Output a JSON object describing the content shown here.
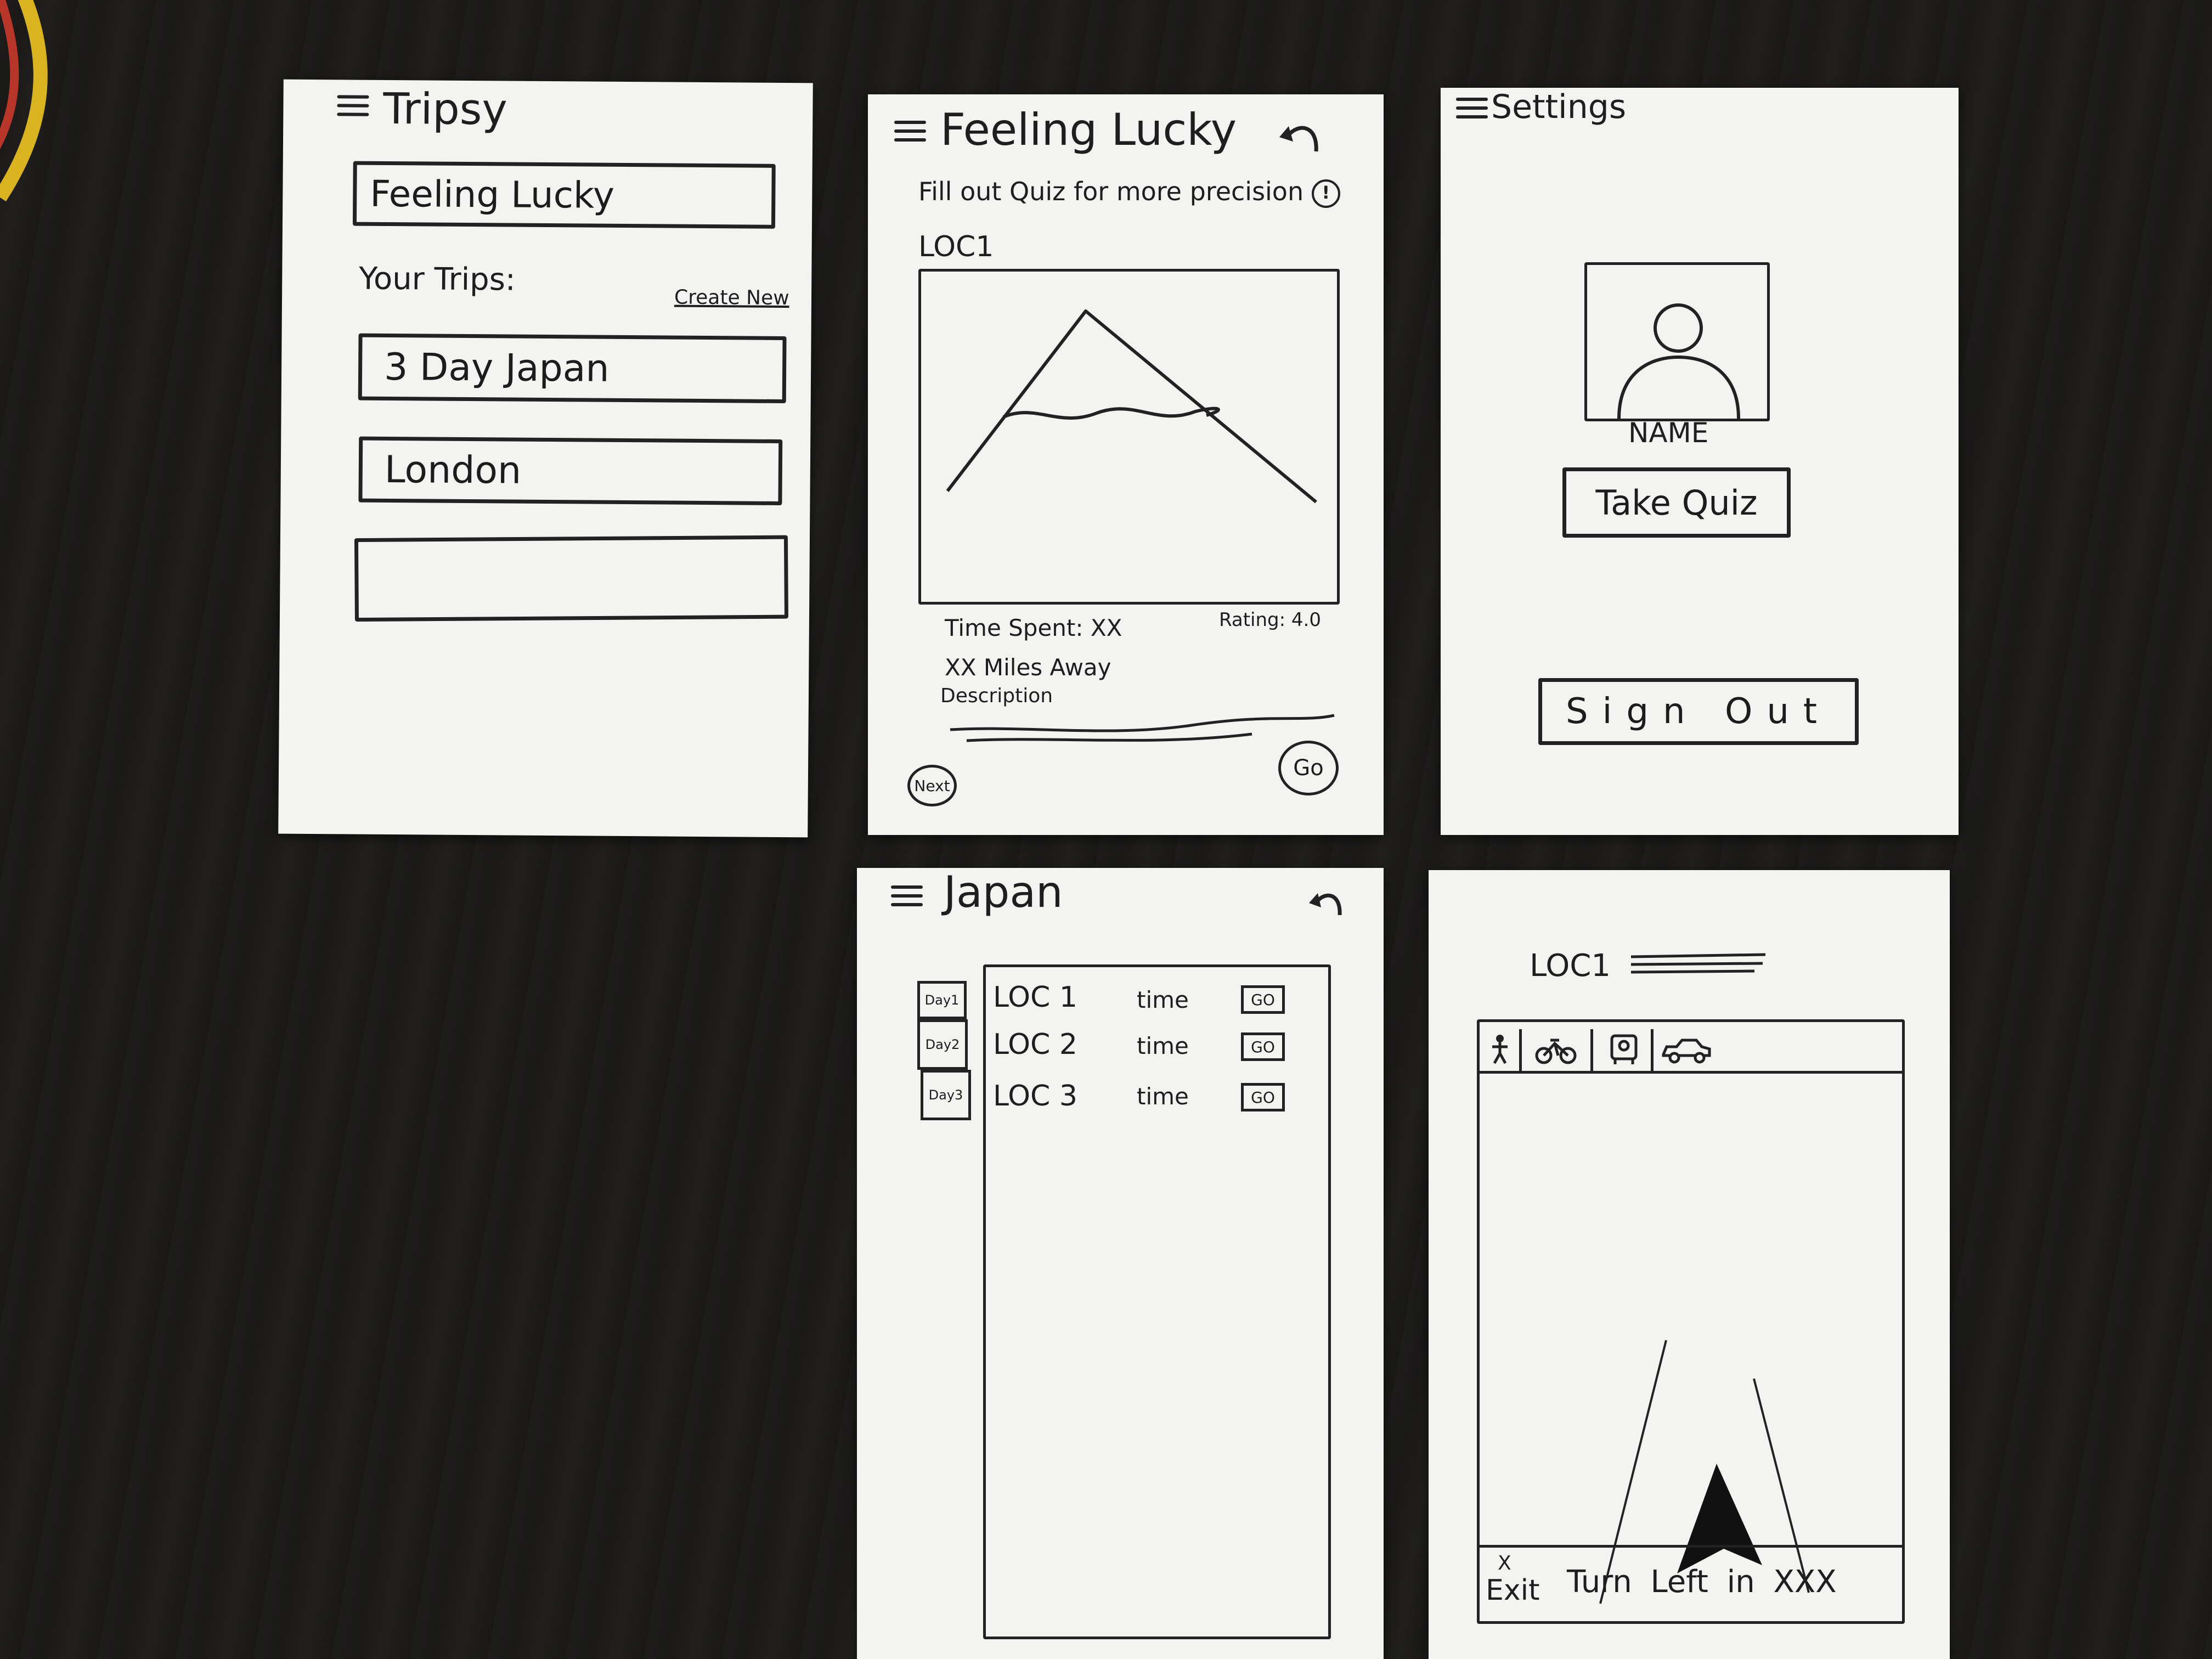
{
  "home": {
    "title": "Tripsy",
    "feeling_lucky": "Feeling Lucky",
    "your_trips": "Your Trips:",
    "create_new": "Create New",
    "trips": [
      "3 Day Japan",
      "London",
      ""
    ]
  },
  "lucky": {
    "title": "Feeling Lucky",
    "quiz_hint": "Fill out Quiz for more precision",
    "loc": "LOC1",
    "time_spent": "Time Spent: XX",
    "rating": "Rating: 4.0",
    "distance": "XX Miles Away",
    "description": "Description",
    "next": "Next",
    "go": "Go"
  },
  "settings": {
    "title": "Settings",
    "name": "NAME",
    "take_quiz": "Take Quiz",
    "sign_out": "Sign Out"
  },
  "japan": {
    "title": "Japan",
    "days": [
      "Day1",
      "Day2",
      "Day3"
    ],
    "rows": [
      {
        "loc": "LOC 1",
        "time": "time",
        "go": "GO"
      },
      {
        "loc": "LOC 2",
        "time": "time",
        "go": "GO"
      },
      {
        "loc": "LOC 3",
        "time": "time",
        "go": "GO"
      }
    ]
  },
  "nav": {
    "loc": "LOC1",
    "modes": [
      "walk-icon",
      "bike-icon",
      "bus-icon",
      "car-icon"
    ],
    "exit_mark": "X",
    "exit": "Exit",
    "instruction": "Turn Left in XXX"
  }
}
